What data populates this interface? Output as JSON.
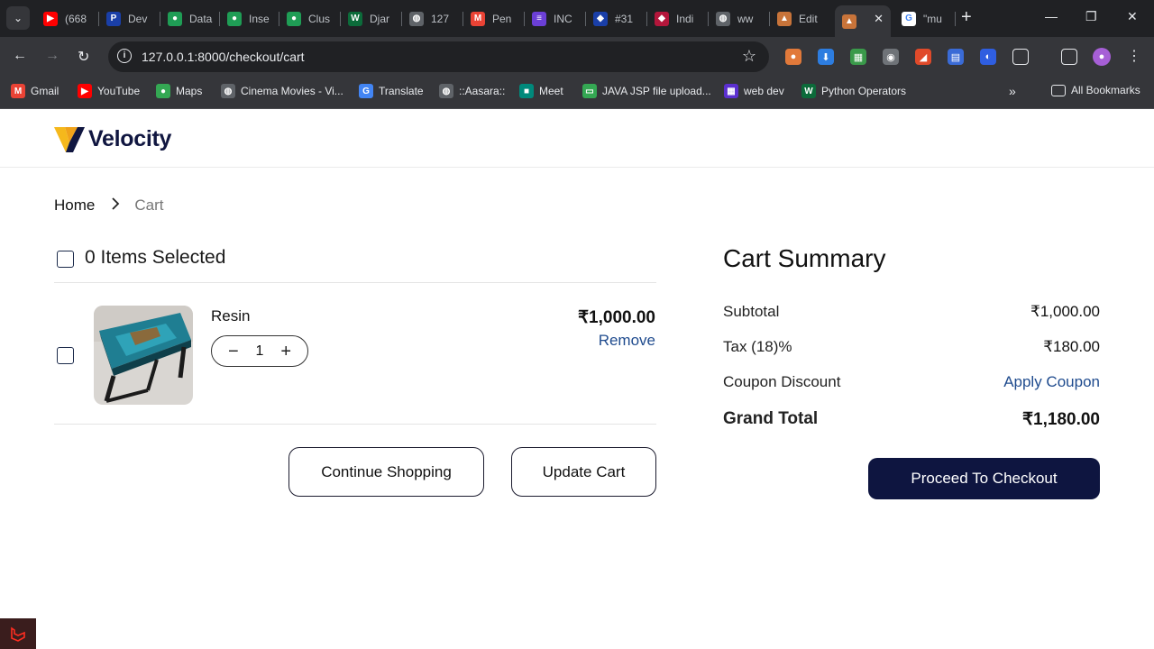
{
  "browser": {
    "tabs": [
      {
        "title": "(668",
        "color": "#ff0000",
        "glyph": "▶"
      },
      {
        "title": "Dev",
        "color": "#1a3fa8",
        "glyph": "P"
      },
      {
        "title": "Data",
        "color": "#1f9d55",
        "glyph": "●"
      },
      {
        "title": "Inse",
        "color": "#1f9d55",
        "glyph": "●"
      },
      {
        "title": "Clus",
        "color": "#1f9d55",
        "glyph": "●"
      },
      {
        "title": "Djar",
        "color": "#0c6b3a",
        "glyph": "W"
      },
      {
        "title": "127",
        "color": "#5f6368",
        "glyph": "◍"
      },
      {
        "title": "Pen",
        "color": "#ea4335",
        "glyph": "M"
      },
      {
        "title": "INC",
        "color": "#6b3fd6",
        "glyph": "≡"
      },
      {
        "title": "#31",
        "color": "#1a3fa8",
        "glyph": "◆"
      },
      {
        "title": "Indi",
        "color": "#b3163b",
        "glyph": "◆"
      },
      {
        "title": "ww",
        "color": "#5f6368",
        "glyph": "◍"
      },
      {
        "title": "Edit",
        "color": "#c8743a",
        "glyph": "▲"
      },
      {
        "title": "",
        "color": "#c8743a",
        "glyph": "▲"
      },
      {
        "title": "\"mu",
        "color": "#4285f4",
        "glyph": "G"
      }
    ],
    "url": "127.0.0.1:8000/checkout/cart",
    "bookmarks": [
      {
        "label": "Gmail",
        "color": "#ea4335",
        "glyph": "M"
      },
      {
        "label": "YouTube",
        "color": "#ff0000",
        "glyph": "▶"
      },
      {
        "label": "Maps",
        "color": "#34a853",
        "glyph": "●"
      },
      {
        "label": "Cinema Movies - Vi...",
        "color": "#5f6368",
        "glyph": "◍"
      },
      {
        "label": "Translate",
        "color": "#4285f4",
        "glyph": "G"
      },
      {
        "label": "::Aasara::",
        "color": "#5f6368",
        "glyph": "◍"
      },
      {
        "label": "Meet",
        "color": "#00897b",
        "glyph": "■"
      },
      {
        "label": "JAVA JSP file upload...",
        "color": "#34a853",
        "glyph": "▭"
      },
      {
        "label": "web dev",
        "color": "#5b2fd0",
        "glyph": "▦"
      },
      {
        "label": "Python Operators",
        "color": "#0c6b3a",
        "glyph": "W"
      }
    ],
    "all_bookmarks": "All Bookmarks"
  },
  "site": {
    "brand": "Velocity"
  },
  "breadcrumb": {
    "home": "Home",
    "current": "Cart"
  },
  "cart": {
    "selected_label": "0 Items Selected",
    "items": [
      {
        "name": "Resin",
        "quantity": "1",
        "price": "₹1,000.00",
        "remove_label": "Remove"
      }
    ],
    "continue_label": "Continue Shopping",
    "update_label": "Update Cart"
  },
  "summary": {
    "title": "Cart Summary",
    "subtotal_label": "Subtotal",
    "subtotal_value": "₹1,000.00",
    "tax_label": "Tax (18)%",
    "tax_value": "₹180.00",
    "coupon_label": "Coupon Discount",
    "coupon_action": "Apply Coupon",
    "grand_label": "Grand Total",
    "grand_value": "₹1,180.00",
    "checkout_label": "Proceed To Checkout"
  }
}
